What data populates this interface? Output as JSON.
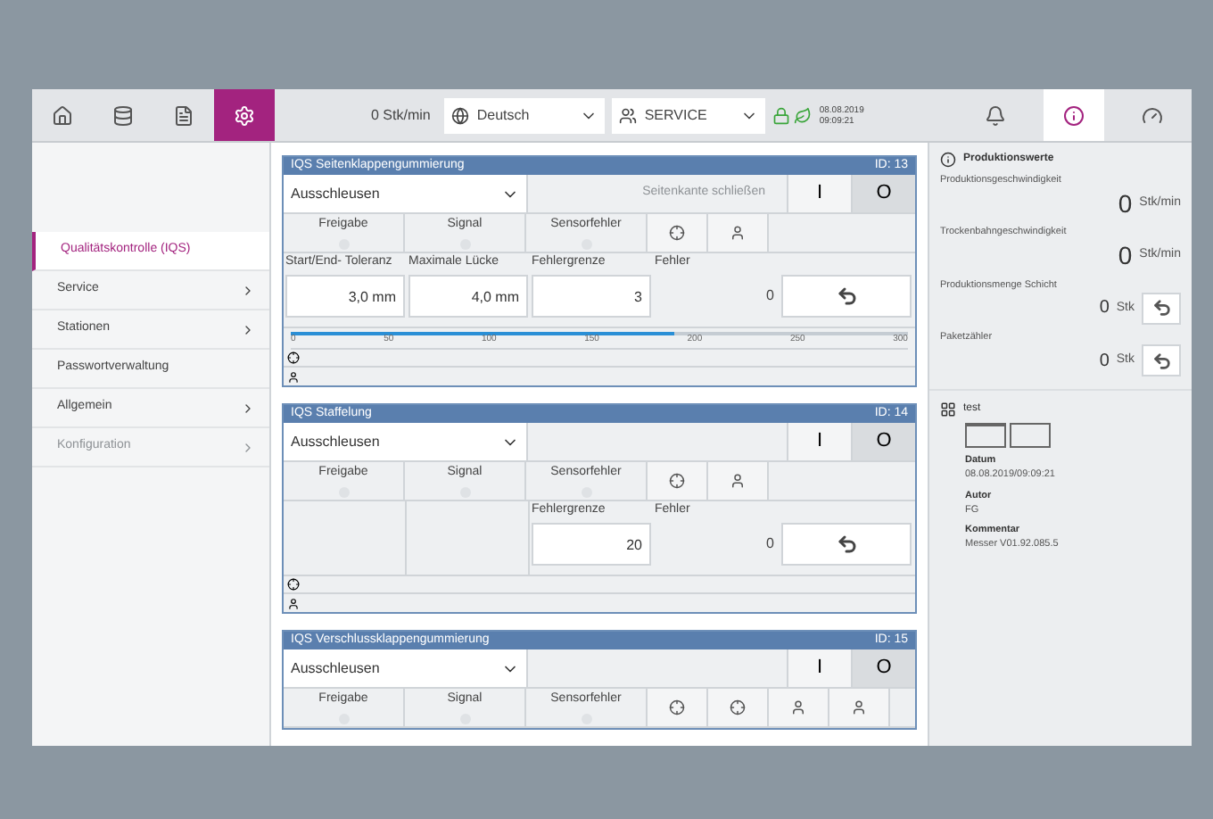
{
  "topbar": {
    "left_tabs": [
      {
        "kind": "home",
        "selected": false
      },
      {
        "kind": "database",
        "selected": false
      },
      {
        "kind": "document",
        "selected": false
      },
      {
        "kind": "gear",
        "selected": true
      }
    ],
    "speed": "0 Stk/min",
    "language": "Deutsch",
    "user": "SERVICE",
    "date": "08.08.2019",
    "time": "09:09:21",
    "right_tabs": [
      {
        "kind": "bell",
        "selected": false
      },
      {
        "kind": "info",
        "selected": true
      },
      {
        "kind": "gauge",
        "selected": false
      }
    ]
  },
  "sidebar": {
    "items": [
      {
        "label": "Qualitätskontrolle (IQS)",
        "selected": true,
        "disabled": false,
        "submenu": false
      },
      {
        "label": "Service",
        "selected": false,
        "disabled": false,
        "submenu": true
      },
      {
        "label": "Stationen",
        "selected": false,
        "disabled": false,
        "submenu": true
      },
      {
        "label": "Passwortverwaltung",
        "selected": false,
        "disabled": false,
        "submenu": false
      },
      {
        "label": "Allgemein",
        "selected": false,
        "disabled": false,
        "submenu": true
      },
      {
        "label": "Konfiguration",
        "selected": false,
        "disabled": true,
        "submenu": true
      }
    ]
  },
  "panels": [
    {
      "title": "IQS Seitenklappengummierung",
      "id": "ID: 13",
      "mode": "Ausschleusen",
      "action": {
        "label": "Seitenkante schließen",
        "disabled": true
      },
      "switches": [
        {
          "label": "I",
          "selected": false
        },
        {
          "label": "O",
          "selected": true
        }
      ],
      "status": [
        "Freigabe",
        "Signal",
        "Sensorfehler"
      ],
      "icon_buttons": [
        {
          "kind": "target"
        },
        {
          "kind": "person"
        }
      ],
      "fields": [
        {
          "label": "Start/End- Toleranz",
          "value": "3,0 mm",
          "kind": "input"
        },
        {
          "label": "Maximale Lücke",
          "value": "4,0 mm",
          "kind": "input"
        },
        {
          "label": "Fehlergrenze",
          "value": "3",
          "kind": "input"
        },
        {
          "label": "Fehler",
          "value": "0",
          "kind": "readout"
        }
      ],
      "ruler": {
        "ticks": [
          "0",
          "50",
          "100",
          "150",
          "200",
          "250",
          "300"
        ],
        "level": 0.62
      }
    },
    {
      "title": "IQS Staffelung",
      "id": "ID: 14",
      "mode": "Ausschleusen",
      "switches": [
        {
          "label": "I",
          "selected": false
        },
        {
          "label": "O",
          "selected": true
        }
      ],
      "status": [
        "Freigabe",
        "Signal",
        "Sensorfehler"
      ],
      "icon_buttons": [
        {
          "kind": "target"
        },
        {
          "kind": "person"
        }
      ],
      "fields": [
        {
          "kind": "blank"
        },
        {
          "kind": "blank"
        },
        {
          "label": "Fehlergrenze",
          "value": "20",
          "kind": "input"
        },
        {
          "label": "Fehler",
          "value": "0",
          "kind": "readout"
        }
      ]
    },
    {
      "title": "IQS Verschlussklappengummierung",
      "id": "ID: 15",
      "mode": "Ausschleusen",
      "switches": [
        {
          "label": "I",
          "selected": false
        },
        {
          "label": "O",
          "selected": true
        }
      ],
      "status": [
        "Freigabe",
        "Signal",
        "Sensorfehler"
      ],
      "icon_buttons": [
        {
          "kind": "target"
        },
        {
          "kind": "target"
        },
        {
          "kind": "person"
        },
        {
          "kind": "person"
        }
      ]
    }
  ],
  "production": {
    "title": "Produktionswerte",
    "metrics": [
      {
        "label": "Produktionsgeschwindigkeit",
        "value": "0",
        "unit": "Stk/min",
        "reset": false
      },
      {
        "label": "Trockenbahngeschwindigkeit",
        "value": "0",
        "unit": "Stk/min",
        "reset": false
      },
      {
        "label": "Produktionsmenge Schicht",
        "value": "0",
        "unit": "Stk",
        "reset": true
      },
      {
        "label": "Paketzähler",
        "value": "0",
        "unit": "Stk",
        "reset": true
      }
    ]
  },
  "job": {
    "name": "test",
    "details": [
      {
        "label": "Datum",
        "value": "08.08.2019/09:09:21"
      },
      {
        "label": "Autor",
        "value": "FG"
      },
      {
        "label": "Kommentar",
        "value": "Messer V01.92.085.5"
      }
    ]
  }
}
